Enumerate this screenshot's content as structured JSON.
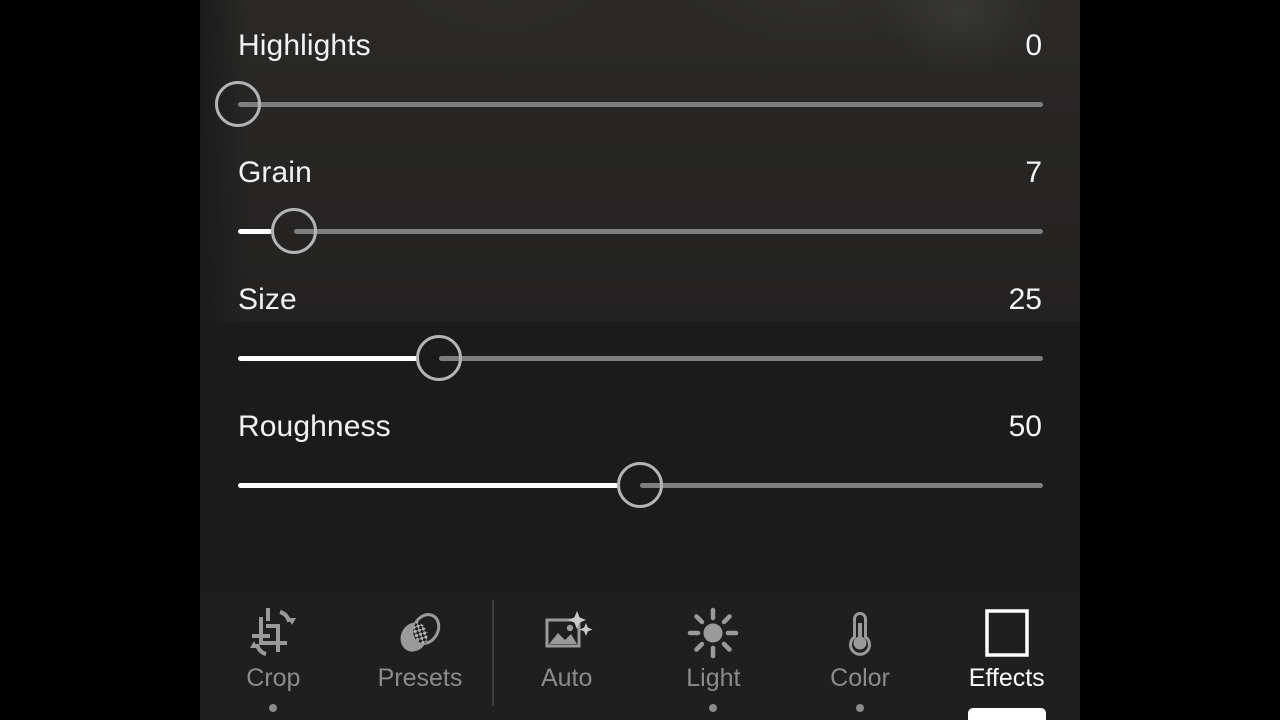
{
  "app": {
    "panel_bg": "#1b1b1b",
    "toolbar_bg": "#1f1f1f",
    "accent": "#ffffff",
    "track_color": "#7e7e7e",
    "thumb_color": "#b4b4b4"
  },
  "sliders": [
    {
      "label": "Highlights",
      "value": "0",
      "percent": 0,
      "min": -100,
      "max": 100,
      "fill_percent": 0
    },
    {
      "label": "Grain",
      "value": "7",
      "percent": 7,
      "min": 0,
      "max": 100,
      "fill_percent": 7
    },
    {
      "label": "Size",
      "value": "25",
      "percent": 25,
      "min": 0,
      "max": 100,
      "fill_percent": 25
    },
    {
      "label": "Roughness",
      "value": "50",
      "percent": 50,
      "min": 0,
      "max": 100,
      "fill_percent": 50
    }
  ],
  "toolbar": {
    "items": [
      {
        "label": "Crop",
        "icon": "crop-rotate-icon",
        "active": false,
        "indicator": "dot"
      },
      {
        "label": "Presets",
        "icon": "presets-icon",
        "active": false,
        "indicator": "none"
      },
      {
        "label": "Auto",
        "icon": "auto-magic-icon",
        "active": false,
        "indicator": "none"
      },
      {
        "label": "Light",
        "icon": "sun-icon",
        "active": false,
        "indicator": "dot"
      },
      {
        "label": "Color",
        "icon": "thermometer-icon",
        "active": false,
        "indicator": "dot"
      },
      {
        "label": "Effects",
        "icon": "vignette-icon",
        "active": true,
        "indicator": "bar"
      }
    ]
  }
}
